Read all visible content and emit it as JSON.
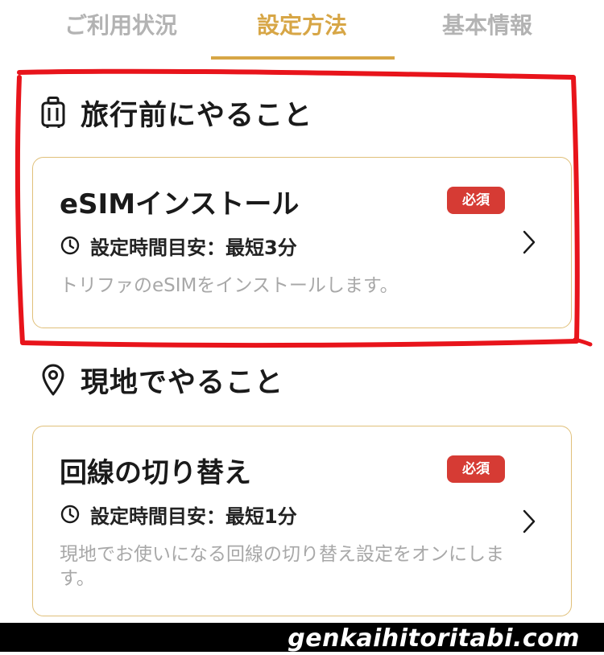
{
  "tabs": [
    {
      "label": "ご利用状況",
      "active": false
    },
    {
      "label": "設定方法",
      "active": true
    },
    {
      "label": "基本情報",
      "active": false
    }
  ],
  "sections": [
    {
      "icon": "suitcase-icon",
      "heading": "旅行前にやること",
      "card": {
        "title": "eSIMインストール",
        "badge": "必須",
        "time": "設定時間目安：最短3分",
        "description": "トリファのeSIMをインストールします。"
      }
    },
    {
      "icon": "location-pin-icon",
      "heading": "現地でやること",
      "card": {
        "title": "回線の切り替え",
        "badge": "必須",
        "time": "設定時間目安：最短1分",
        "description": "現地でお使いになる回線の切り替え設定をオンにします。"
      }
    }
  ],
  "watermark": "genkaihitoritabi.com",
  "colors": {
    "accent": "#d7a646",
    "badge": "#d63b34",
    "highlight": "#e8141b",
    "card_border": "#e0c07a"
  }
}
